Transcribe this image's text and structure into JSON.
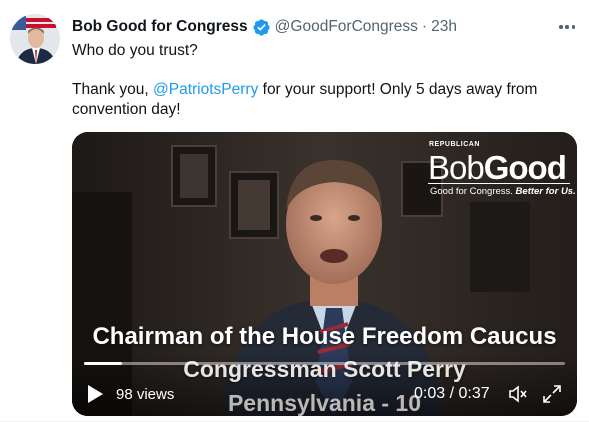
{
  "tweet": {
    "author_name": "Bob Good for Congress",
    "handle": "@GoodForCongress",
    "separator": "·",
    "time": "23h",
    "line1": "Who do you trust?",
    "line2_prefix": "Thank you, ",
    "mention": "@PatriotsPerry",
    "line2_suffix": " for your support! Only 5 days away from",
    "line3": "convention day!"
  },
  "video": {
    "logo_small": "REPUBLICAN",
    "logo_bob": "Bob",
    "logo_good": "Good",
    "logo_tag_plain": "Good for Congress. ",
    "logo_tag_bold": "Better for Us.",
    "caption_line1": "Chairman of the House Freedom Caucus",
    "caption_line2": "Congressman Scott Perry",
    "caption_line3": "Pennsylvania - 10",
    "views": "98 views",
    "time_display": "0:03 / 0:37",
    "progress_fraction": 0.08
  },
  "icons": {
    "verified": "verified-badge-icon",
    "more": "more-options-icon",
    "play": "play-icon",
    "mute": "volume-muted-icon",
    "expand": "fullscreen-expand-icon"
  },
  "colors": {
    "link": "#1d9bf0",
    "verified": "#1d9bf0",
    "secondary_text": "#536471"
  }
}
